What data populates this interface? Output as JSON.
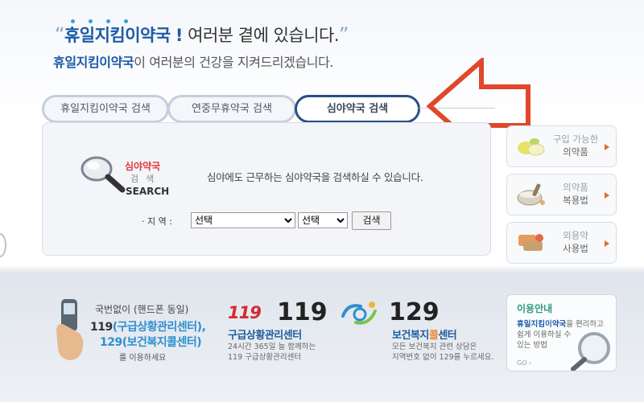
{
  "hero": {
    "brand": "휴일지킴이약국",
    "headline_open": "“",
    "headline_mark": "!",
    "headline_rest": "여러분 곁에 있습니다.",
    "headline_close": "”",
    "sub_rest": "이 여러분의 건강을 지켜드리겠습니다."
  },
  "tabs": [
    {
      "label": "휴일지킴이약국 검색"
    },
    {
      "label": "연중무휴약국 검색"
    },
    {
      "label": "심야약국 검색",
      "active": true
    }
  ],
  "search": {
    "logo_line1": "심야약국",
    "logo_line2": "검색",
    "logo_line3": "SEARCH",
    "description": "심야에도 근무하는 심야약국을 검색하실 수 있습니다.",
    "region_label": "· 지 역 :",
    "select1_value": "선택",
    "select2_value": "선택",
    "button_label": "검색"
  },
  "side_links": [
    {
      "line1": "구입 가능한",
      "line2": "의약품"
    },
    {
      "line1": "의약품",
      "line2": "복용법"
    },
    {
      "line1": "외용약",
      "line2": "사용법"
    }
  ],
  "info": {
    "phone_line1": "국번없이 (핸드폰 동일)",
    "phone_line2_num": "119",
    "phone_line2_name": "(구급상황관리센터),",
    "phone_line3": "129(보건복지콜센터)",
    "phone_line4": "를 이용하세요",
    "ems_logo": "119",
    "ems_number": "119",
    "ems_title": "구급상황관리센터",
    "ems_desc1": "24시간 365일 늘 함께하는",
    "ems_desc2": "119 구급상황관리센터",
    "welfare_number": "129",
    "welfare_title_pre": "보건복지",
    "welfare_title_hl": "콜",
    "welfare_title_post": "센터",
    "welfare_desc1": "모든 보건복지 관련 상담은",
    "welfare_desc2": "지역번호 없이 129를 누르세요."
  },
  "guide": {
    "title": "이용안내",
    "desc_brand": "휴일지킴이약국",
    "desc_rest1": "을 편리하고",
    "desc_line2": "쉽게 이용하실 수",
    "desc_line3": "있는 방법",
    "go": "GO ›"
  },
  "colors": {
    "brand_blue": "#1d5aa8",
    "active_tab_border": "#2a4f84",
    "arrow_red": "#e0472b",
    "accent_orange": "#e8682a"
  }
}
